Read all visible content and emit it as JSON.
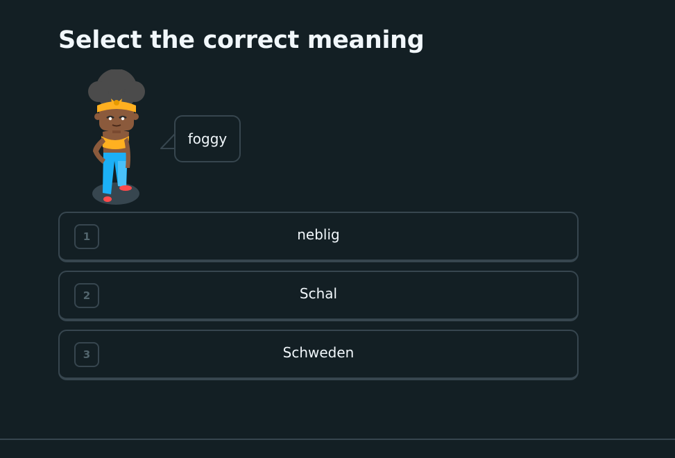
{
  "challenge": {
    "title": "Select the correct meaning",
    "prompt_word": "foggy"
  },
  "options": [
    {
      "number": "1",
      "label": "neblig"
    },
    {
      "number": "2",
      "label": "Schal"
    },
    {
      "number": "3",
      "label": "Schweden"
    }
  ],
  "colors": {
    "background": "#131f24",
    "border": "#37464f",
    "text": "#f1f7fb",
    "muted": "#52656d"
  },
  "icons": {
    "character": "character-illustration",
    "bubble": "speech-bubble-tail"
  }
}
